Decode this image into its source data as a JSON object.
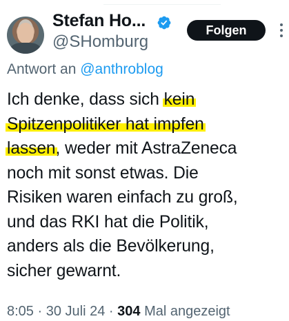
{
  "author": {
    "display_name": "Stefan Ho...",
    "handle": "@SHomburg",
    "verified": true,
    "avatar_icon": "profile-photo"
  },
  "follow_button": {
    "label": "Folgen"
  },
  "reply_context": {
    "prefix": "Antwort an ",
    "mention": "@anthroblog"
  },
  "tweet": {
    "lines": [
      {
        "text": "Ich denke, dass sich ",
        "hl": "kein"
      },
      {
        "hl": "Spitzenpolitiker hat impfen"
      },
      {
        "hl": "lassen",
        "text_after": ", weder mit AstraZeneca"
      },
      {
        "text": "noch mit sonst etwas. Die"
      },
      {
        "text": "Risiken waren einfach zu groß,"
      },
      {
        "text": "und das RKI hat die Politik,"
      },
      {
        "text": "anders als die Bevölkerung,"
      },
      {
        "text": "sicher gewarnt."
      }
    ],
    "highlight_color": "#ffef00"
  },
  "meta": {
    "time": "8:05",
    "date": "30 Juli 24",
    "views_count": "304",
    "views_label": "Mal angezeigt"
  },
  "colors": {
    "text": "#0f1419",
    "secondary": "#536471",
    "link": "#1d9bf0",
    "verified": "#1d9bf0"
  }
}
